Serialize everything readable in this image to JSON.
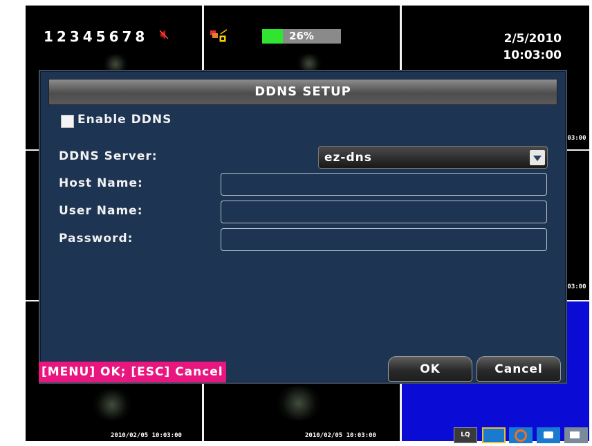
{
  "status_bar": {
    "camera_numbers": "12345678",
    "record_progress_percent": 26,
    "record_progress_text": "26%",
    "date": "2/5/2010",
    "time": "10:03:00"
  },
  "channel_timestamps": {
    "ch1": "2010/02/05 10:03:00",
    "ch2": "2010/02/05 10:03:00",
    "edge1": ":03:00",
    "edge2": ":03:00"
  },
  "dialog": {
    "title": "DDNS SETUP",
    "enable_label": "Enable DDNS",
    "enable_checked": false,
    "server_label": "DDNS Server:",
    "server_value": "ez-dns",
    "host_label": "Host Name:",
    "host_value": "",
    "user_label": "User Name:",
    "user_value": "",
    "password_label": "Password:",
    "password_value": "",
    "ok_label": "OK",
    "cancel_label": "Cancel",
    "hint": "[MENU] OK; [ESC] Cancel"
  },
  "toolbar": {
    "lq_label": "LQ",
    "icons": [
      "lq-icon",
      "display-icon",
      "ring-icon",
      "camera-icon",
      "snapshot-icon"
    ]
  },
  "colors": {
    "dialog_bg": "#1e3453",
    "hint_bg": "#e8167e",
    "progress_fill": "#32e432",
    "channel_blue": "#0b0bd6"
  }
}
